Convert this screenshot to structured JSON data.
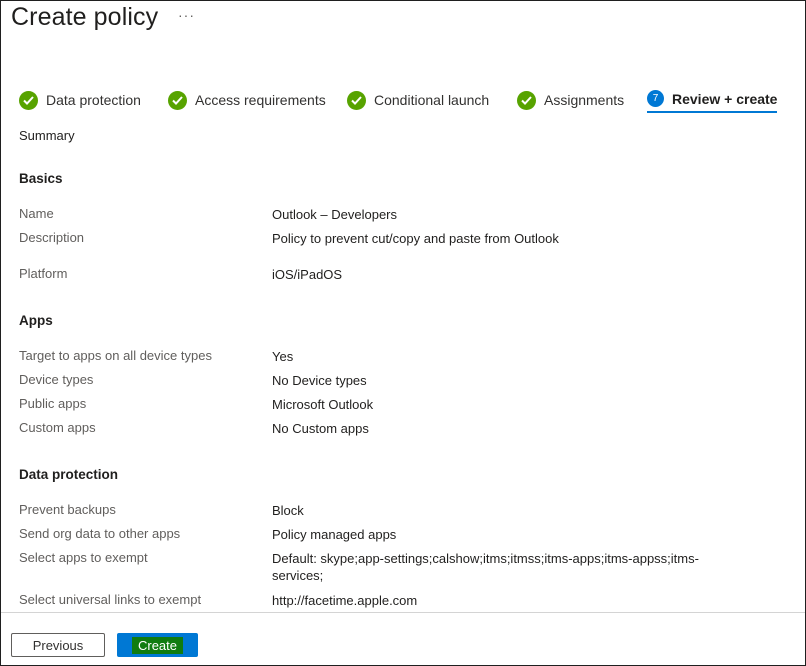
{
  "page": {
    "title": "Create policy",
    "more": "···"
  },
  "steps": [
    {
      "label": "Data protection",
      "state": "done"
    },
    {
      "label": "Access requirements",
      "state": "done"
    },
    {
      "label": "Conditional launch",
      "state": "done"
    },
    {
      "label": "Assignments",
      "state": "done"
    },
    {
      "label": "Review + create",
      "state": "active",
      "number": "7"
    }
  ],
  "summary_label": "Summary",
  "basics": {
    "heading": "Basics",
    "rows": [
      {
        "key": "Name",
        "value": "Outlook – Developers"
      },
      {
        "key": "Description",
        "value": "Policy to prevent cut/copy and paste from Outlook"
      },
      {
        "key": "Platform",
        "value": "iOS/iPadOS"
      }
    ]
  },
  "apps": {
    "heading": "Apps",
    "rows": [
      {
        "key": "Target to apps on all device types",
        "value": "Yes"
      },
      {
        "key": "Device types",
        "value": "No Device types"
      },
      {
        "key": "Public apps",
        "value": "Microsoft Outlook"
      },
      {
        "key": "Custom apps",
        "value": "No Custom apps"
      }
    ]
  },
  "data_protection": {
    "heading": "Data protection",
    "rows": [
      {
        "key": "Prevent backups",
        "value": "Block"
      },
      {
        "key": "Send org data to other apps",
        "value": "Policy managed apps"
      },
      {
        "key": "Select apps to exempt",
        "value": "Default: skype;app-settings;calshow;itms;itmss;itms-apps;itms-appss;itms-services;"
      },
      {
        "key": "Select universal links to exempt",
        "value": "http://facetime.apple.com"
      }
    ]
  },
  "footer": {
    "previous_label": "Previous",
    "create_label": "Create"
  },
  "colors": {
    "accent": "#0078d4",
    "check": "#57a300",
    "create_highlight": "#107c10"
  }
}
